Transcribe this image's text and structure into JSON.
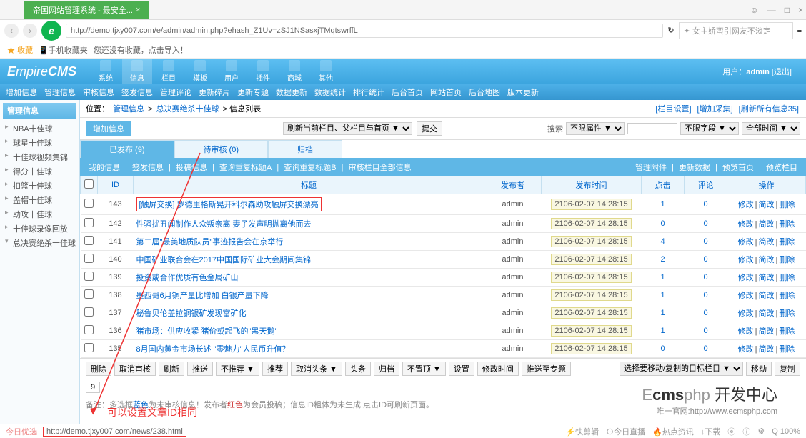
{
  "browser": {
    "tab_title": "帝国网站管理系统 - 最安全...",
    "url": "http://demo.tjxy007.com/e/admin/admin.php?ehash_Z1Uv=zSJ1NSasxjTMqtswrffL",
    "search_placeholder": "✦ 女主娇蛮引网友不淡定",
    "fav_star": "★ 收藏",
    "fav_mobile": "📱手机收藏夹",
    "fav_tip": "您还没有收藏，点击导入！"
  },
  "cms": {
    "logo_a": "E",
    "logo_b": "mpire",
    "logo_c": "CMS",
    "top_icons": [
      "系统",
      "信息",
      "栏目",
      "模板",
      "用户",
      "插件",
      "商城",
      "其他"
    ],
    "user_label": "用户：",
    "user_name": "admin",
    "logout": "[退出]",
    "subnav": [
      "增加信息",
      "管理信息",
      "审核信息",
      "签发信息",
      "管理评论",
      "更新碎片",
      "更新专题",
      "数据更新",
      "数据统计",
      "排行统计",
      "后台首页",
      "网站首页",
      "后台地图",
      "版本更新"
    ]
  },
  "sidebar": {
    "title": "管理信息",
    "items": [
      "NBA十佳球",
      "球星十佳球",
      "十佳球视频集锦",
      "得分十佳球",
      "扣篮十佳球",
      "盖帽十佳球",
      "助攻十佳球",
      "十佳球录像回放",
      "总决赛绝杀十佳球"
    ]
  },
  "crumb": {
    "loc": "位置：",
    "a": "管理信息",
    "b": "总决赛绝杀十佳球",
    "c": "信息列表",
    "right_links": [
      "[栏目设置]",
      "[增加采集]",
      "[刷新所有信息35]"
    ]
  },
  "actionbar": {
    "add": "增加信息",
    "refresh_sel": "刷新当前栏目、父栏目与首页 ▼",
    "submit": "提交",
    "search": "搜索",
    "f1": "不限属性 ▼",
    "f2": "不限字段 ▼",
    "f3": "全部时间 ▼"
  },
  "tabs": {
    "t1": "已发布 (9)",
    "t2": "待审核 (0)",
    "t3": "归档"
  },
  "subleft": [
    "我的信息",
    "签发信息",
    "投稿信息",
    "查询重复标题A",
    "查询重复标题B",
    "审核栏目全部信息"
  ],
  "subright": [
    "管理附件",
    "更新数据",
    "预览首页",
    "预览栏目"
  ],
  "grid": {
    "headers": {
      "chk": "",
      "id": "ID",
      "title": "标题",
      "author": "发布者",
      "time": "发布时间",
      "clicks": "点击",
      "comments": "评论",
      "ops": "操作"
    },
    "rows": [
      {
        "id": "143",
        "title": "[触屏交换] 罗德里格斯晃开科尔森助攻触屏交换漂亮",
        "hl": true,
        "author": "admin",
        "time": "2106-02-07 14:28:15",
        "clicks": "1",
        "comments": "0"
      },
      {
        "id": "142",
        "title": "性骚扰丑闻制作人众叛亲离 妻子发声明抛离他而去",
        "author": "admin",
        "time": "2106-02-07 14:28:15",
        "clicks": "0",
        "comments": "0"
      },
      {
        "id": "141",
        "title": "第二届\"最美地质队员\"事迹报告会在京举行",
        "author": "admin",
        "time": "2106-02-07 14:28:15",
        "clicks": "4",
        "comments": "0"
      },
      {
        "id": "140",
        "title": "中国矿业联合会在2017中国国际矿业大会期间集锦",
        "author": "admin",
        "time": "2106-02-07 14:28:15",
        "clicks": "2",
        "comments": "0"
      },
      {
        "id": "139",
        "title": "投资或合作优质有色金属矿山",
        "author": "admin",
        "time": "2106-02-07 14:28:15",
        "clicks": "1",
        "comments": "0"
      },
      {
        "id": "138",
        "title": "墨西哥6月铜产量比增加 白银产量下降",
        "author": "admin",
        "time": "2106-02-07 14:28:15",
        "clicks": "1",
        "comments": "0"
      },
      {
        "id": "137",
        "title": "秘鲁贝伦盖拉铜银矿发现富矿化",
        "author": "admin",
        "time": "2106-02-07 14:28:15",
        "clicks": "1",
        "comments": "0"
      },
      {
        "id": "136",
        "title": "猪市场：供应收紧 猪价或起飞的\"黑天鹅\"",
        "author": "admin",
        "time": "2106-02-07 14:28:15",
        "clicks": "1",
        "comments": "0"
      },
      {
        "id": "135",
        "title": "8月国内黄金市场长述 \"零魅力\"人民币升值？",
        "author": "admin",
        "time": "2106-02-07 14:28:15",
        "clicks": "0",
        "comments": "0"
      }
    ],
    "op_edit": "修改",
    "op_copy": "简改",
    "op_del": "删除"
  },
  "botbtns": [
    "删除",
    "取消审核",
    "刷新",
    "推送",
    "不推荐 ▼",
    "推荐",
    "取消头条 ▼",
    "头条",
    "归档",
    "不置顶 ▼",
    "设置",
    "修改时间",
    "推送至专题"
  ],
  "movebar": {
    "label": "选择要移动/复制的目标栏目 ▼",
    "b1": "移动",
    "b2": "复制"
  },
  "pager": {
    "page": "9"
  },
  "note": {
    "pre": "备注：多选框",
    "blue": "蓝色",
    "mid": "为未审核信息！发布者",
    "red": "红色",
    "suf": "为会员投稿；信息ID粗体为未生成,点击ID可刷新页面。"
  },
  "annot": "可以设置文章ID相同",
  "statusbar": {
    "today": "今日优选",
    "url": "http://demo.tjxy007.com/news/238.html",
    "r": [
      "⚡快剪辑",
      "⊙今日直播",
      "🔥热点资讯",
      "↓下载",
      "ⓔ",
      "ⓘ",
      "⚙",
      "Q 100%"
    ]
  },
  "wm": {
    "a": "E",
    "b": "cms",
    "c": "php ",
    "d": "开发中心",
    "sub": "唯一官网:http://www.ecmsphp.com"
  }
}
